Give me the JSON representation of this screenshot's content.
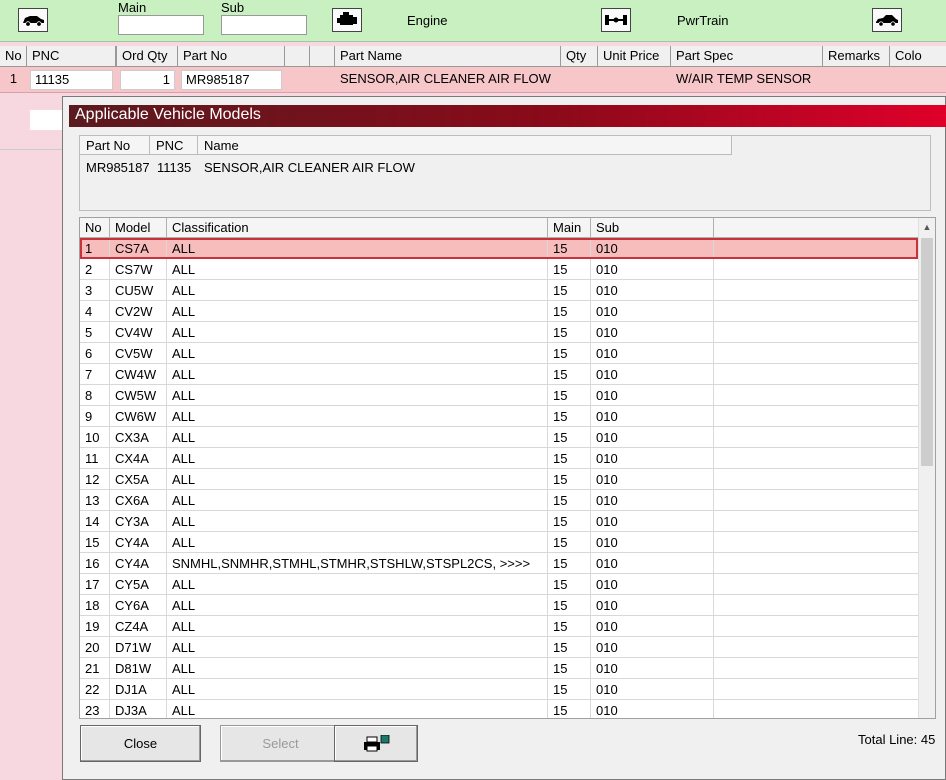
{
  "toolbar": {
    "main_label": "Main",
    "sub_label": "Sub",
    "main_value": "",
    "sub_value": "",
    "engine_label": "Engine",
    "pwrtrain_label": "PwrTrain"
  },
  "main_grid": {
    "headers": [
      "No",
      "PNC",
      "",
      "Ord Qty",
      "Part No",
      "",
      "",
      "Part Name",
      "Qty",
      "Unit Price",
      "Part Spec",
      "Remarks",
      "Colo"
    ],
    "row": {
      "no": "1",
      "pnc": "11135",
      "ord_qty": "1",
      "part_no": "MR985187",
      "part_name": "SENSOR,AIR CLEANER AIR FLOW",
      "part_spec": "W/AIR TEMP SENSOR"
    }
  },
  "dialog": {
    "title": "Applicable Vehicle Models",
    "part_headers": {
      "part_no": "Part No",
      "pnc": "PNC",
      "name": "Name"
    },
    "part_values": {
      "part_no": "MR985187",
      "pnc": "11135",
      "name": "SENSOR,AIR CLEANER AIR FLOW"
    },
    "grid_headers": {
      "no": "No",
      "model": "Model",
      "classification": "Classification",
      "main": "Main",
      "sub": "Sub"
    },
    "rows": [
      {
        "no": "1",
        "model": "CS7A",
        "cls": "ALL",
        "main": "15",
        "sub": "010"
      },
      {
        "no": "2",
        "model": "CS7W",
        "cls": "ALL",
        "main": "15",
        "sub": "010"
      },
      {
        "no": "3",
        "model": "CU5W",
        "cls": "ALL",
        "main": "15",
        "sub": "010"
      },
      {
        "no": "4",
        "model": "CV2W",
        "cls": "ALL",
        "main": "15",
        "sub": "010"
      },
      {
        "no": "5",
        "model": "CV4W",
        "cls": "ALL",
        "main": "15",
        "sub": "010"
      },
      {
        "no": "6",
        "model": "CV5W",
        "cls": "ALL",
        "main": "15",
        "sub": "010"
      },
      {
        "no": "7",
        "model": "CW4W",
        "cls": "ALL",
        "main": "15",
        "sub": "010"
      },
      {
        "no": "8",
        "model": "CW5W",
        "cls": "ALL",
        "main": "15",
        "sub": "010"
      },
      {
        "no": "9",
        "model": "CW6W",
        "cls": "ALL",
        "main": "15",
        "sub": "010"
      },
      {
        "no": "10",
        "model": "CX3A",
        "cls": "ALL",
        "main": "15",
        "sub": "010"
      },
      {
        "no": "11",
        "model": "CX4A",
        "cls": "ALL",
        "main": "15",
        "sub": "010"
      },
      {
        "no": "12",
        "model": "CX5A",
        "cls": "ALL",
        "main": "15",
        "sub": "010"
      },
      {
        "no": "13",
        "model": "CX6A",
        "cls": "ALL",
        "main": "15",
        "sub": "010"
      },
      {
        "no": "14",
        "model": "CY3A",
        "cls": "ALL",
        "main": "15",
        "sub": "010"
      },
      {
        "no": "15",
        "model": "CY4A",
        "cls": "ALL",
        "main": "15",
        "sub": "010"
      },
      {
        "no": "16",
        "model": "CY4A",
        "cls": "SNMHL,SNMHR,STMHL,STMHR,STSHLW,STSPL2CS,  >>>>",
        "main": "15",
        "sub": "010"
      },
      {
        "no": "17",
        "model": "CY5A",
        "cls": "ALL",
        "main": "15",
        "sub": "010"
      },
      {
        "no": "18",
        "model": "CY6A",
        "cls": "ALL",
        "main": "15",
        "sub": "010"
      },
      {
        "no": "19",
        "model": "CZ4A",
        "cls": "ALL",
        "main": "15",
        "sub": "010"
      },
      {
        "no": "20",
        "model": "D71W",
        "cls": "ALL",
        "main": "15",
        "sub": "010"
      },
      {
        "no": "21",
        "model": "D81W",
        "cls": "ALL",
        "main": "15",
        "sub": "010"
      },
      {
        "no": "22",
        "model": "DJ1A",
        "cls": "ALL",
        "main": "15",
        "sub": "010"
      },
      {
        "no": "23",
        "model": "DJ3A",
        "cls": "ALL",
        "main": "15",
        "sub": "010"
      }
    ],
    "buttons": {
      "close": "Close",
      "select": "Select"
    },
    "total_line": "Total Line: 45"
  },
  "colors": {
    "toolbar_bg": "#c8f0c0",
    "selected_row": "#f7bcbc",
    "selection_border": "#c8323a",
    "title_gradient_end": "#e0002a"
  },
  "icons": [
    "car-icon",
    "engine-icon",
    "axle-icon",
    "car-side-icon",
    "printer-icon"
  ]
}
